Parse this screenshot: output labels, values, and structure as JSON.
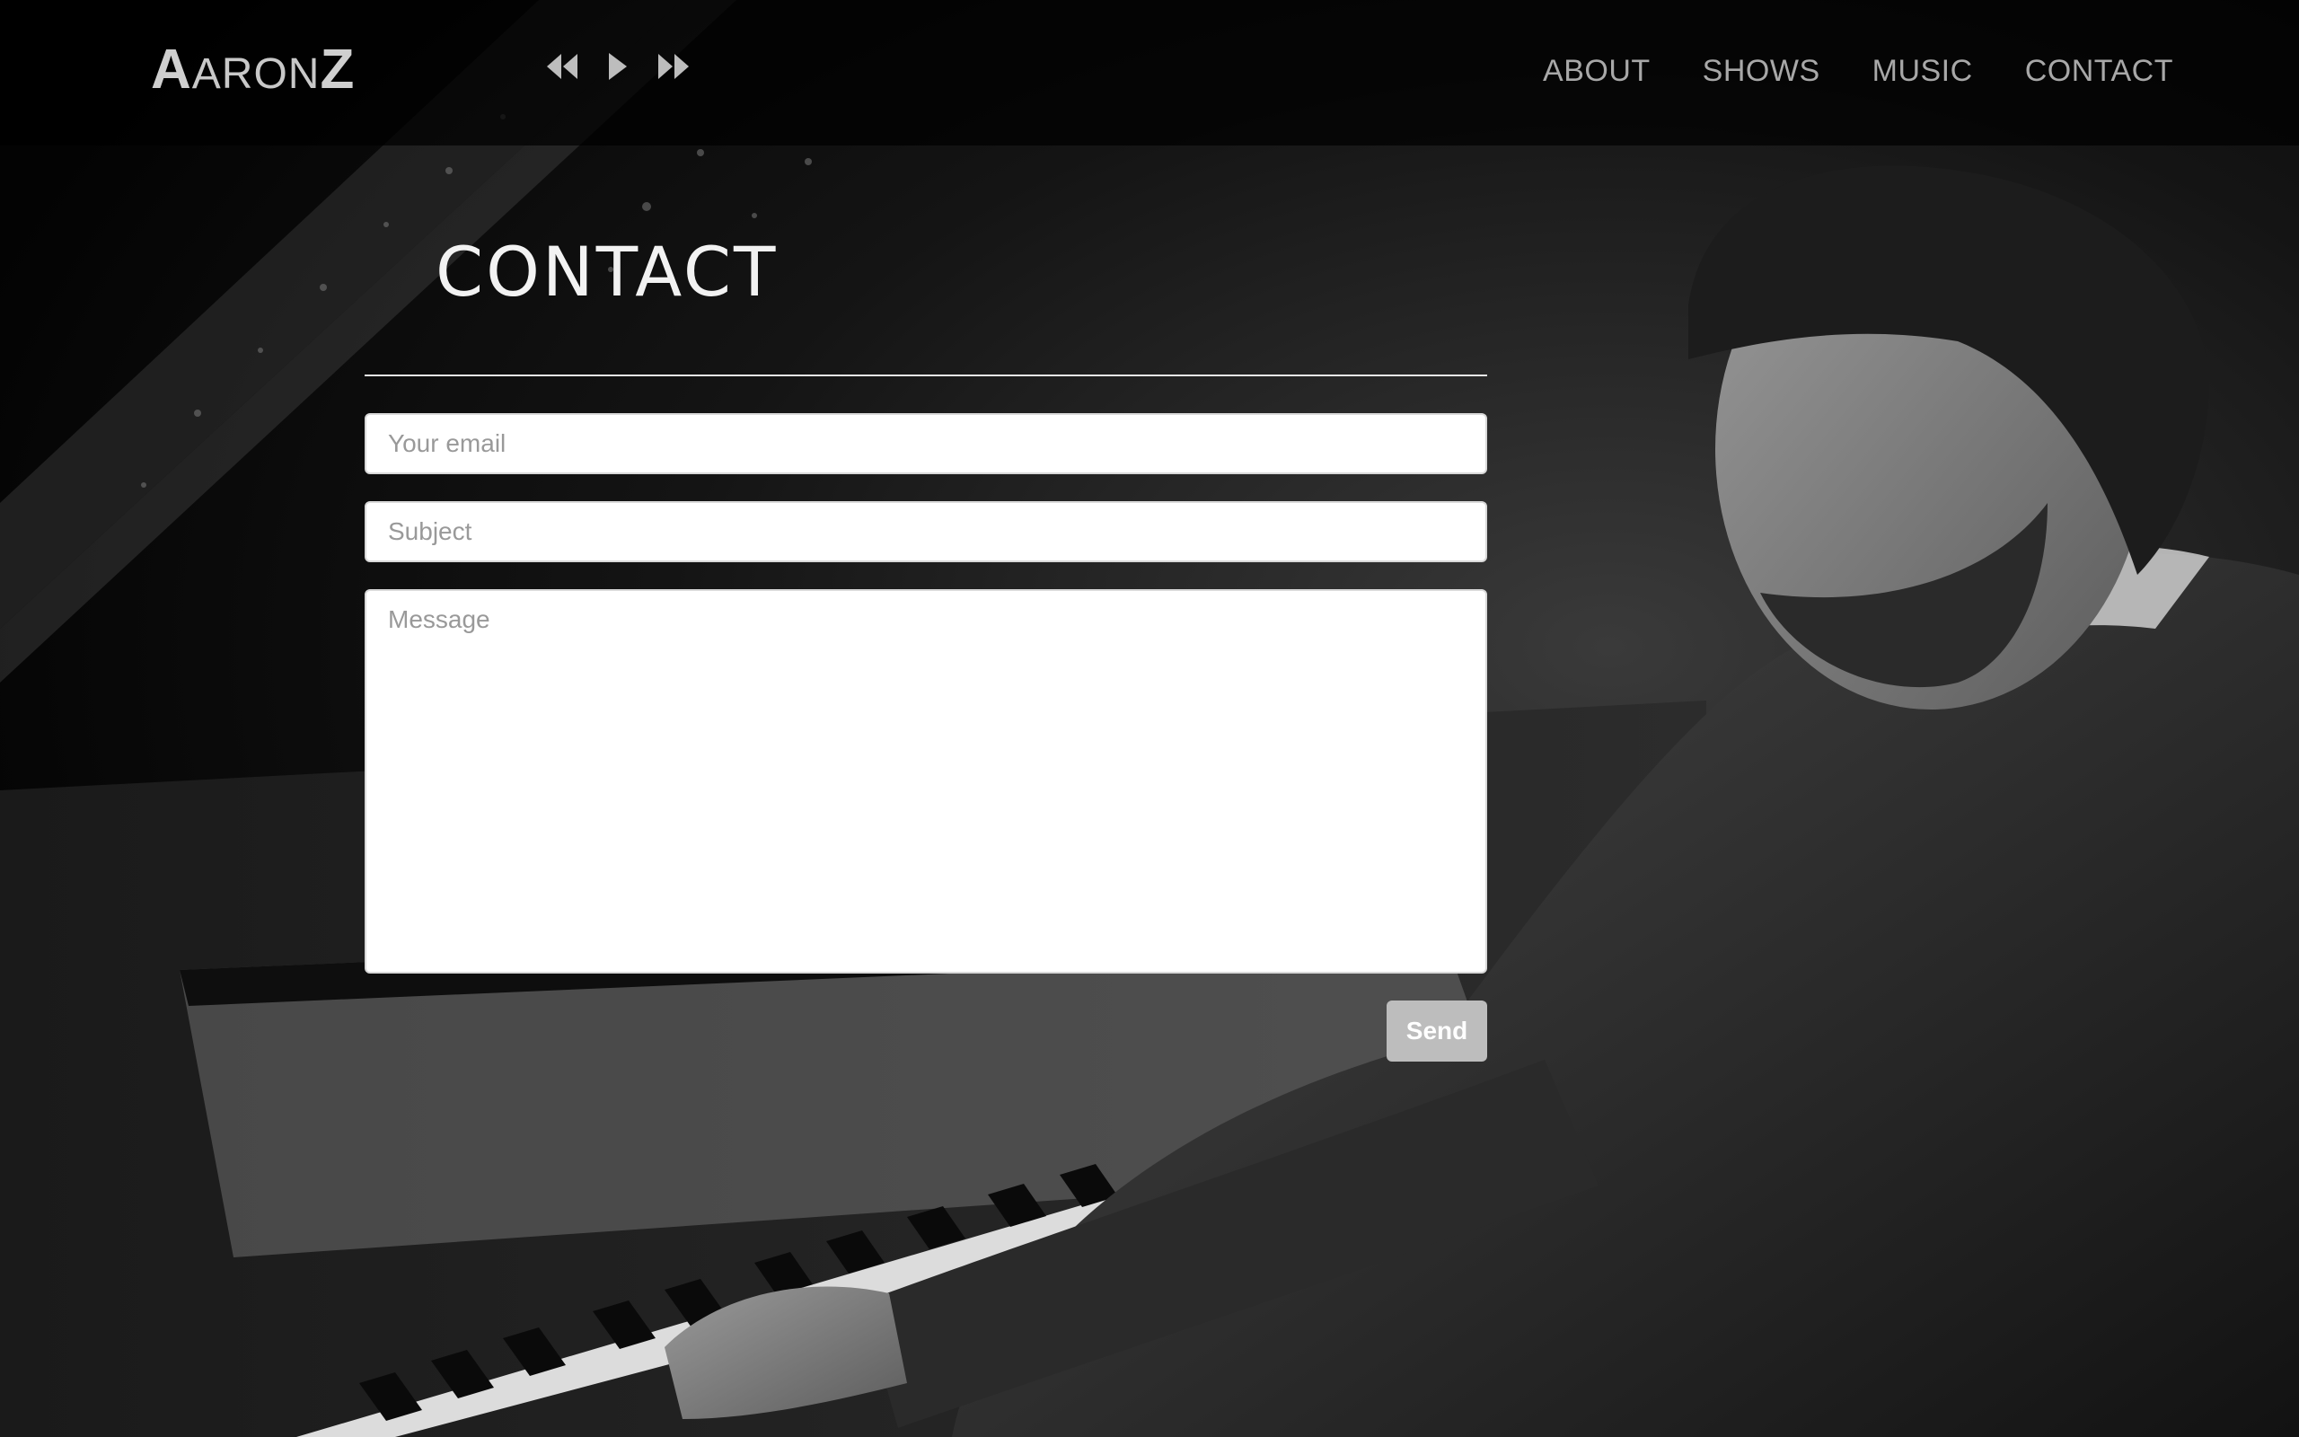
{
  "brand": {
    "first_initial": "A",
    "middle": "ARON",
    "last_initial": "Z"
  },
  "player": {
    "controls": [
      {
        "name": "rewind",
        "icon": "rewind-icon"
      },
      {
        "name": "play",
        "icon": "play-icon"
      },
      {
        "name": "fast-forward",
        "icon": "fast-forward-icon"
      }
    ]
  },
  "nav": {
    "items": [
      {
        "label": "ABOUT"
      },
      {
        "label": "SHOWS"
      },
      {
        "label": "MUSIC"
      },
      {
        "label": "CONTACT"
      }
    ]
  },
  "contact": {
    "title": "CONTACT",
    "email_placeholder": "Your email",
    "email_value": "",
    "subject_placeholder": "Subject",
    "subject_value": "",
    "message_placeholder": "Message",
    "message_value": "",
    "send_label": "Send"
  },
  "colors": {
    "header_bg": "#000000",
    "nav_text": "#a8a8a8",
    "title_text": "#f2f2f2",
    "send_button": "#bdbdbd"
  }
}
